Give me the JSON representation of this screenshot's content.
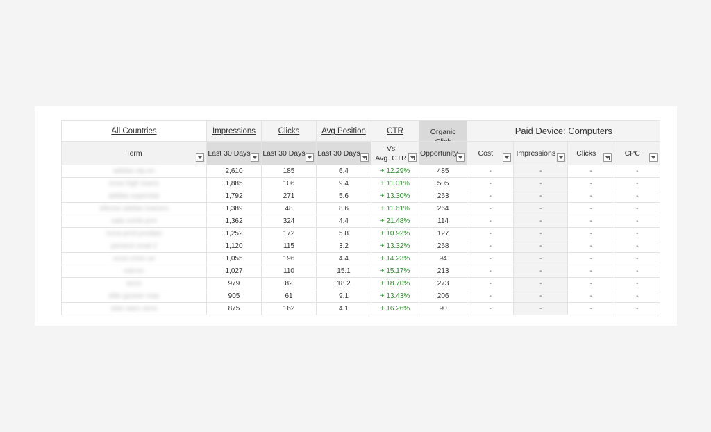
{
  "header": {
    "all_countries": "All Countries",
    "impressions": "Impressions",
    "clicks": "Clicks",
    "avg_position": "Avg Position",
    "ctr": "CTR",
    "organic_click": "Organic Click",
    "paid_device": "Paid Device: Computers"
  },
  "subheader": {
    "term": "Term",
    "imp_period": "Last 30 Days",
    "clk_period": "Last 30 Days",
    "pos_period": "Last 30 Days",
    "ctr_vs_1": "Vs",
    "ctr_vs_2": "Avg. CTR",
    "opportunity": "Opportunity",
    "cost": "Cost",
    "paid_impressions": "Impressions",
    "paid_clicks": "Clicks",
    "cpc": "CPC"
  },
  "rows": [
    {
      "term": "adidas.ntp.en",
      "impressions": "2,610",
      "clicks": "185",
      "avg_position": "6.4",
      "ctr": "+ 12.29%",
      "opportunity": "485",
      "cost": "-",
      "paid_impressions": "-",
      "paid_clicks": "-",
      "cpc": "-"
    },
    {
      "term": "eosa high towns",
      "impressions": "1,885",
      "clicks": "106",
      "avg_position": "9.4",
      "ctr": "+ 11.01%",
      "opportunity": "505",
      "cost": "-",
      "paid_impressions": "-",
      "paid_clicks": "-",
      "cpc": "-"
    },
    {
      "term": "adidas superstar",
      "impressions": "1,792",
      "clicks": "271",
      "avg_position": "5.6",
      "ctr": "+ 13.30%",
      "opportunity": "263",
      "cost": "-",
      "paid_impressions": "-",
      "paid_clicks": "-",
      "cpc": "-"
    },
    {
      "term": "ellesse adidas trainers",
      "impressions": "1,389",
      "clicks": "48",
      "avg_position": "8.6",
      "ctr": "+ 11.61%",
      "opportunity": "264",
      "cost": "-",
      "paid_impressions": "-",
      "paid_clicks": "-",
      "cpc": "-"
    },
    {
      "term": "sala comb prm",
      "impressions": "1,362",
      "clicks": "324",
      "avg_position": "4.4",
      "ctr": "+ 21.48%",
      "opportunity": "114",
      "cost": "-",
      "paid_impressions": "-",
      "paid_clicks": "-",
      "cpc": "-"
    },
    {
      "term": "nona prml predato",
      "impressions": "1,252",
      "clicks": "172",
      "avg_position": "5.8",
      "ctr": "+ 10.92%",
      "opportunity": "127",
      "cost": "-",
      "paid_impressions": "-",
      "paid_clicks": "-",
      "cpc": "-"
    },
    {
      "term": "pereeot srsal 2",
      "impressions": "1,120",
      "clicks": "115",
      "avg_position": "3.2",
      "ctr": "+ 13.32%",
      "opportunity": "268",
      "cost": "-",
      "paid_impressions": "-",
      "paid_clicks": "-",
      "cpc": "-"
    },
    {
      "term": "ocsa cnsis ue",
      "impressions": "1,055",
      "clicks": "196",
      "avg_position": "4.4",
      "ctr": "+ 14.23%",
      "opportunity": "94",
      "cost": "-",
      "paid_impressions": "-",
      "paid_clicks": "-",
      "cpc": "-"
    },
    {
      "term": "earron",
      "impressions": "1,027",
      "clicks": "110",
      "avg_position": "15.1",
      "ctr": "+ 15.17%",
      "opportunity": "213",
      "cost": "-",
      "paid_impressions": "-",
      "paid_clicks": "-",
      "cpc": "-"
    },
    {
      "term": "aons",
      "impressions": "979",
      "clicks": "82",
      "avg_position": "18.2",
      "ctr": "+ 18.70%",
      "opportunity": "273",
      "cost": "-",
      "paid_impressions": "-",
      "paid_clicks": "-",
      "cpc": "-"
    },
    {
      "term": "elite gozeer max",
      "impressions": "905",
      "clicks": "61",
      "avg_position": "9.1",
      "ctr": "+ 13.43%",
      "opportunity": "206",
      "cost": "-",
      "paid_impressions": "-",
      "paid_clicks": "-",
      "cpc": "-"
    },
    {
      "term": "stan wars sens",
      "impressions": "875",
      "clicks": "162",
      "avg_position": "4.1",
      "ctr": "+ 16.26%",
      "opportunity": "90",
      "cost": "-",
      "paid_impressions": "-",
      "paid_clicks": "-",
      "cpc": "-"
    }
  ],
  "colors": {
    "background": "#f4f4f4",
    "card": "#ffffff",
    "ctr_positive": "#2e8b2e",
    "header_highlight": "#d9d9d9"
  }
}
